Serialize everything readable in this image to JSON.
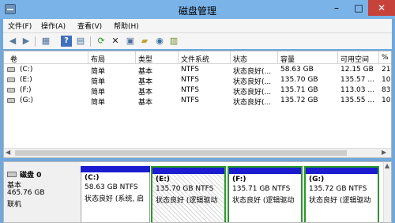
{
  "window": {
    "title": "磁盘管理",
    "min_label": "–",
    "max_label": "□",
    "close_label": "✕"
  },
  "menu": [
    "文件(F)",
    "操作(A)",
    "查看(V)",
    "帮助(H)"
  ],
  "toolbar": [
    "back-icon",
    "forward-icon",
    "console-tree-icon",
    "help-icon",
    "properties-icon",
    "refresh-icon",
    "delete-icon",
    "export-icon",
    "folder-open-icon",
    "search-disk-icon",
    "settings-disk-icon"
  ],
  "table": {
    "headers": [
      "卷",
      "布局",
      "类型",
      "文件系统",
      "状态",
      "容量",
      "可用空间",
      "%"
    ],
    "rows": [
      [
        "(C:)",
        "简单",
        "基本",
        "NTFS",
        "状态良好(...",
        "58.63 GB",
        "12.15 GB",
        "21"
      ],
      [
        "(E:)",
        "简单",
        "基本",
        "NTFS",
        "状态良好(...",
        "135.70 GB",
        "135.57 ...",
        "10"
      ],
      [
        "(F:)",
        "简单",
        "基本",
        "NTFS",
        "状态良好(...",
        "135.71 GB",
        "113.03 ...",
        "83"
      ],
      [
        "(G:)",
        "简单",
        "基本",
        "NTFS",
        "状态良好(...",
        "135.72 GB",
        "135.55 ...",
        "10"
      ]
    ]
  },
  "disk": {
    "name": "磁盘 0",
    "type": "基本",
    "size": "465.76 GB",
    "status": "联机"
  },
  "partitions": [
    {
      "label": "(C:)",
      "size": "58.63 GB NTFS",
      "status": "状态良好 (系统, 启"
    },
    {
      "label": "(E:)",
      "size": "135.70 GB NTFS",
      "status": "状态良好 (逻辑驱动"
    },
    {
      "label": "(F:)",
      "size": "135.71 GB NTFS",
      "status": "状态良好 (逻辑驱动"
    },
    {
      "label": "(G:)",
      "size": "135.72 GB NTFS",
      "status": "状态良好 (逻辑驱动"
    }
  ]
}
